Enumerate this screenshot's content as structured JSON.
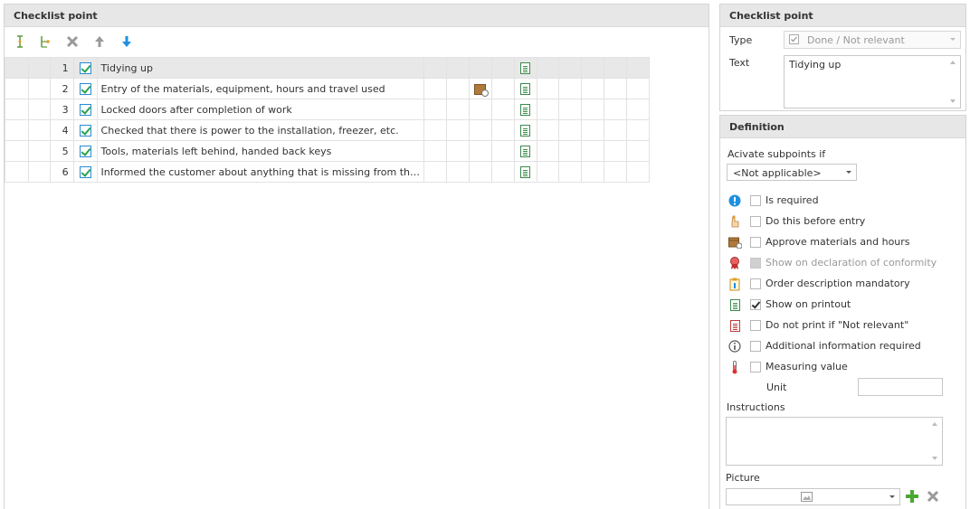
{
  "left_panel": {
    "title": "Checklist point",
    "toolbar": {
      "add": "add-item-icon",
      "add_sub": "add-subitem-icon",
      "delete": "delete-icon",
      "up": "move-up-icon",
      "down": "move-down-icon"
    },
    "rows": [
      {
        "num": "1",
        "text": "Tidying up",
        "selected": true,
        "box": false
      },
      {
        "num": "2",
        "text": "Entry of the materials, equipment, hours and travel used",
        "selected": false,
        "box": true
      },
      {
        "num": "3",
        "text": "Locked doors after completion of work",
        "selected": false,
        "box": false
      },
      {
        "num": "4",
        "text": "Checked that there is power to the installation, freezer, etc.",
        "selected": false,
        "box": false
      },
      {
        "num": "5",
        "text": "Tools, materials left behind, handed back keys",
        "selected": false,
        "box": false
      },
      {
        "num": "6",
        "text": "Informed the customer about anything that is missing from the installation",
        "selected": false,
        "box": false
      }
    ]
  },
  "right_panel": {
    "title": "Checklist point",
    "type_label": "Type",
    "type_value": "Done / Not relevant",
    "text_label": "Text",
    "text_value": "Tidying up"
  },
  "definition": {
    "title": "Definition",
    "activate_label": "Acivate subpoints if",
    "activate_value": "<Not applicable>",
    "options": [
      {
        "label": "Is required",
        "icon": "exclamation-icon",
        "checked": false,
        "disabled": false
      },
      {
        "label": "Do this before entry",
        "icon": "hand-icon",
        "checked": false,
        "disabled": false
      },
      {
        "label": "Approve materials and hours",
        "icon": "box-icon",
        "checked": false,
        "disabled": false
      },
      {
        "label": "Show on declaration of conformity",
        "icon": "ribbon-icon",
        "checked": false,
        "disabled": true
      },
      {
        "label": "Order description mandatory",
        "icon": "clipboard-icon",
        "checked": false,
        "disabled": false
      },
      {
        "label": "Show on printout",
        "icon": "document-icon",
        "checked": true,
        "disabled": false
      },
      {
        "label": "Do not print if \"Not relevant\"",
        "icon": "document-red-icon",
        "checked": false,
        "disabled": false
      },
      {
        "label": "Additional information required",
        "icon": "info-icon",
        "checked": false,
        "disabled": false
      },
      {
        "label": "Measuring value",
        "icon": "thermometer-icon",
        "checked": false,
        "disabled": false
      }
    ],
    "unit_label": "Unit",
    "unit_value": "",
    "instructions_label": "Instructions",
    "instructions_value": "",
    "picture_label": "Picture"
  },
  "colors": {
    "accent_blue": "#2a8ad4",
    "add_green": "#4aa832",
    "header_bg": "#e7e7e7"
  }
}
